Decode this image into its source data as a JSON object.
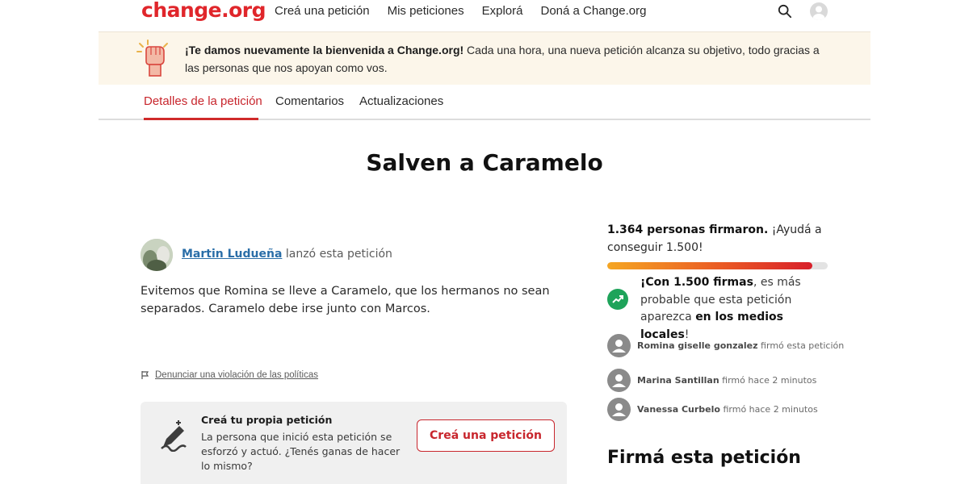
{
  "header": {
    "logo": "change.org",
    "nav": [
      "Creá una petición",
      "Mis peticiones",
      "Explorá",
      "Doná a Change.org"
    ]
  },
  "banner": {
    "bold": "¡Te damos nuevamente la bienvenida a Change.org!",
    "text": " Cada una hora, una nueva petición alcanza su objetivo, todo gracias a las personas que nos apoyan como vos."
  },
  "tabs": [
    "Detalles de la petición",
    "Comentarios",
    "Actualizaciones"
  ],
  "petition": {
    "title": "Salven a Caramelo",
    "author": "Martin Ludueña",
    "author_suffix": " lanzó esta petición",
    "description": "Evitemos que Romina se lleve a Caramelo, que los hermanos no sean separados. Caramelo debe irse junto con Marcos.",
    "report_link": "Denunciar una violación de las políticas"
  },
  "create_box": {
    "title": "Creá tu propia petición",
    "text": "La persona que inició esta petición se esforzó y actuó. ¿Tenés ganas de hacer lo mismo?",
    "button": "Creá una petición"
  },
  "signatures": {
    "count_text": "1.364 personas firmaron.",
    "cta_text": " ¡Ayudá a conseguir 1.500!",
    "progress_fraction": 0.93,
    "goal_bold1": "¡Con 1.500 firmas",
    "goal_text1": ", es más probable que esta petición aparezca ",
    "goal_bold2": "en los medios locales",
    "goal_text2": "!",
    "signers": [
      {
        "name": "Romina giselle gonzalez",
        "action": " firmó esta petición"
      },
      {
        "name": "Marina Santillan",
        "action": " firmó hace 2 minutos"
      },
      {
        "name": "Vanessa Curbelo",
        "action": " firmó hace 2 minutos"
      }
    ],
    "sign_heading": "Firmá esta petición"
  },
  "colors": {
    "brand": "#e0262b",
    "link": "#2a6ea8",
    "success": "#1ea35a"
  }
}
